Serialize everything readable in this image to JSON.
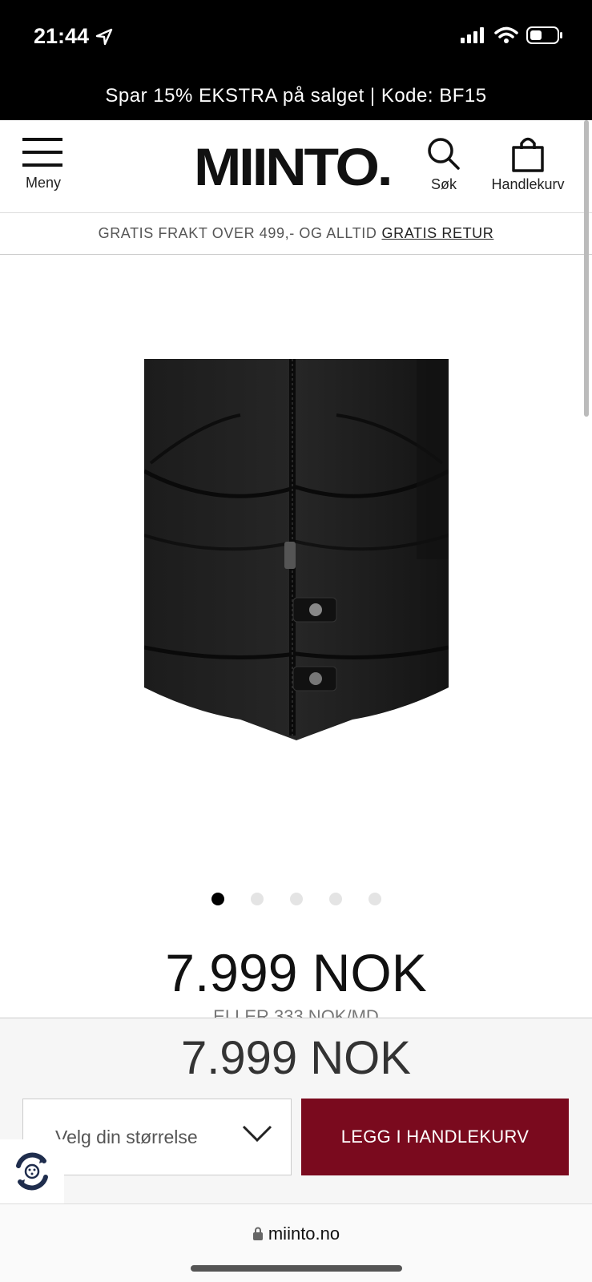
{
  "status_bar": {
    "time": "21:44"
  },
  "promo": {
    "text": "Spar 15% EKSTRA på salget | Kode: BF15"
  },
  "header": {
    "menu_label": "Meny",
    "logo": "MIINTO.",
    "search_label": "Søk",
    "cart_label": "Handlekurv"
  },
  "shipping": {
    "text": "GRATIS FRAKT OVER 499,- OG ALLTID",
    "link": "GRATIS RETUR"
  },
  "product": {
    "carousel": {
      "count": 5,
      "active_index": 0
    },
    "price": "7.999 NOK",
    "installment": "ELLER 333 NOK/MD"
  },
  "sticky_bar": {
    "price": "7.999 NOK",
    "size_placeholder": "Velg din størrelse",
    "add_to_cart": "LEGG I HANDLEKURV"
  },
  "browser": {
    "url": "miinto.no"
  },
  "colors": {
    "accent": "#7a0a1e",
    "dark": "#000000"
  }
}
